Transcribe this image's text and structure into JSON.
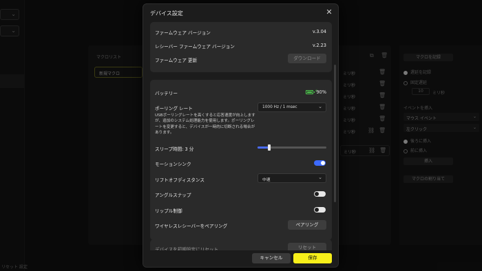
{
  "background": {
    "macro_list_title": "マクロリスト",
    "macro_item": "新規マクロ",
    "rows": [
      {
        "label": "ミリ秒"
      },
      {
        "label": "ミリ秒"
      },
      {
        "label": "ミリ秒"
      },
      {
        "label": "ミリ秒"
      },
      {
        "label": "ミリ秒"
      },
      {
        "label": "ミリ秒"
      },
      {
        "label": "ミリ秒"
      }
    ],
    "right": {
      "record_button": "マクロを記録",
      "record_delay": "遅延を記録",
      "fixed_delay": "固定遅延",
      "delay_value": "10",
      "delay_unit": "ミリ秒",
      "insert_event_title": "イベントを挿入",
      "event_type": "マウス イベント",
      "event_action": "左クリック",
      "insert_after": "後ろに挿入",
      "insert_before": "前に挿入",
      "insert_button": "挿入",
      "assign_button": "マクロの割り当て"
    },
    "bottom_label": "リセット 設定"
  },
  "modal": {
    "title": "デバイス設定",
    "firmware": {
      "version_label": "ファームウェア バージョン",
      "version_value": "v.3.04",
      "receiver_label": "レシーバー ファームウェア バージョン",
      "receiver_value": "v.2.23",
      "update_label": "ファームウェア 更新",
      "download_button": "ダウンロード"
    },
    "settings": {
      "battery_label": "バッテリー",
      "battery_value": "90%",
      "battery_level": 0.9,
      "polling_label": "ポーリング レート",
      "polling_value": "1000 Hz / 1 msec",
      "polling_desc": "USBポーリングレートを高くすると応答速度が向上しますが、追加のシステム処理能力を使用します。ポーリングレートを変更すると、デバイスが一時的に切断される場合があります。",
      "sleep_label": "スリープ時間: 3 分",
      "sleep_slider_fraction": 0.17,
      "motion_sync_label": "モーションシンク",
      "motion_sync_on": true,
      "lod_label": "リフトオフディスタンス",
      "lod_value": "中速",
      "angle_snap_label": "アングルスナップ",
      "angle_snap_on": false,
      "ripple_label": "リップル制御",
      "ripple_on": false,
      "pairing_label": "ワイヤレスレシーバーをペアリング",
      "pairing_button": "ペアリング"
    },
    "partial_row": {
      "label": "デバイスを初期設定にリセット",
      "button": "リセット"
    },
    "footer": {
      "cancel": "キャンセル",
      "save": "保存"
    }
  }
}
